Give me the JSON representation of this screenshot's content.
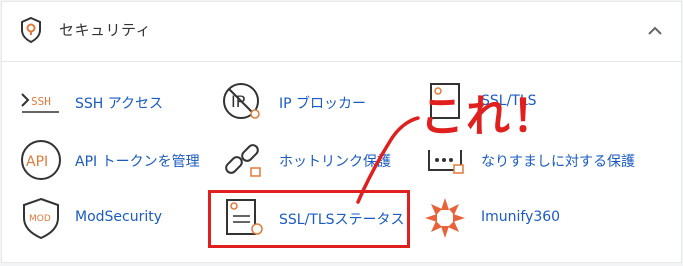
{
  "section": {
    "title": "セキュリティ",
    "icon": "shield-icon",
    "collapse_icon": "chevron-up-icon"
  },
  "items": [
    {
      "label": "SSH アクセス",
      "icon": "terminal-ssh-icon"
    },
    {
      "label": "IP ブロッカー",
      "icon": "ip-blocker-icon"
    },
    {
      "label": "SSL/TLS",
      "icon": "ssl-tls-icon"
    },
    {
      "label": "API トークンを管理",
      "icon": "api-icon"
    },
    {
      "label": "ホットリンク保護",
      "icon": "hotlink-protection-icon"
    },
    {
      "label": "なりすましに対する保護",
      "icon": "spoofing-protection-icon"
    },
    {
      "label": "ModSecurity",
      "icon": "modsecurity-icon"
    },
    {
      "label": "SSL/TLSステータス",
      "icon": "ssl-tls-status-icon"
    },
    {
      "label": "Imunify360",
      "icon": "imunify360-icon"
    }
  ],
  "annotation": {
    "text": "これ！",
    "color": "#e01f1f"
  },
  "colors": {
    "link": "#1a5bc1",
    "icon_stroke": "#444444",
    "icon_accent": "#e07a3a",
    "highlight": "#e01f1f"
  }
}
